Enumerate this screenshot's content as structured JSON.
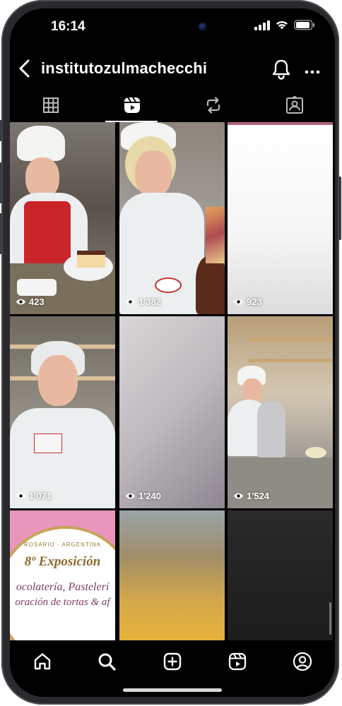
{
  "status_bar": {
    "time": "16:14"
  },
  "header": {
    "username": "institutozulmachecchi"
  },
  "tabs": [
    {
      "icon": "grid-icon",
      "active": false
    },
    {
      "icon": "reels-icon",
      "active": true
    },
    {
      "icon": "reposts-icon",
      "active": false
    },
    {
      "icon": "tagged-icon",
      "active": false
    }
  ],
  "reels": [
    {
      "views": "423"
    },
    {
      "views": "1'382"
    },
    {
      "views": "923"
    },
    {
      "views": "1'071"
    },
    {
      "views": "1'240"
    },
    {
      "views": "1'524"
    },
    {
      "views": ""
    },
    {
      "views": ""
    },
    {
      "views": ""
    }
  ],
  "poster": {
    "line_top": "ROSARIO · ARGENTINA",
    "title": "8º Exposición",
    "line1": "ocolatería, Pastelerí",
    "line2": "oración de tortas & af"
  },
  "bottom_nav": [
    {
      "icon": "home-icon"
    },
    {
      "icon": "search-icon"
    },
    {
      "icon": "create-icon"
    },
    {
      "icon": "reels-nav-icon"
    },
    {
      "icon": "profile-icon"
    }
  ],
  "colors": {
    "background": "#000000",
    "text": "#ffffff",
    "poster_pink": "#e88fb6",
    "poster_gold": "#c9a35a"
  }
}
